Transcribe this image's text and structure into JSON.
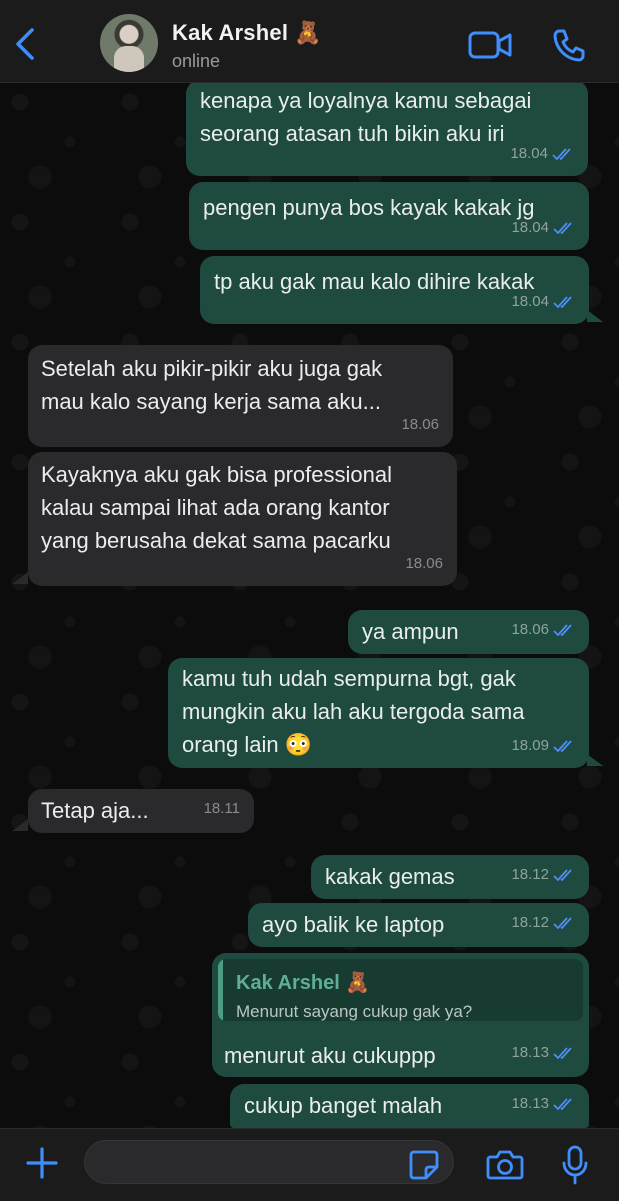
{
  "header": {
    "contact_name": "Kak Arshel 🧸",
    "status": "online"
  },
  "messages": [
    {
      "direction": "out",
      "text": "kenapa ya loyalnya kamu sebagai\nseorang atasan tuh bikin aku iri",
      "time": "18.04"
    },
    {
      "direction": "out",
      "text": "pengen punya bos kayak kakak jg",
      "time": "18.04"
    },
    {
      "direction": "out",
      "text": "tp aku gak mau kalo dihire kakak",
      "time": "18.04"
    },
    {
      "direction": "in",
      "text": "Setelah aku pikir-pikir aku juga gak\nmau kalo sayang kerja sama aku...",
      "time": "18.06"
    },
    {
      "direction": "in",
      "text": "Kayaknya aku gak bisa professional\nkalau sampai lihat ada orang kantor\nyang berusaha dekat sama pacarku",
      "time": "18.06"
    },
    {
      "direction": "out",
      "text": "ya ampun",
      "time": "18.06"
    },
    {
      "direction": "out",
      "text": "kamu tuh udah sempurna bgt, gak\nmungkin aku lah aku tergoda sama\norang lain 😳",
      "time": "18.09"
    },
    {
      "direction": "in",
      "text": "Tetap aja...",
      "time": "18.11"
    },
    {
      "direction": "out",
      "text": "kakak gemas",
      "time": "18.12"
    },
    {
      "direction": "out",
      "text": "ayo balik ke laptop",
      "time": "18.12"
    },
    {
      "direction": "out",
      "text": "menurut aku cukuppp",
      "time": "18.13",
      "quote": {
        "name": "Kak Arshel 🧸",
        "text": "Menurut sayang cukup gak ya?"
      }
    },
    {
      "direction": "out",
      "text": "cukup banget malah",
      "time": "18.13"
    }
  ],
  "colors": {
    "outgoing_bubble": "#1f4a3f",
    "incoming_bubble": "#2a2a2c",
    "accent": "#3f8efc",
    "read_ticks": "#4f8ef7"
  },
  "icons": [
    "chevron-left-icon",
    "video-call-icon",
    "phone-icon",
    "plus-icon",
    "sticker-icon",
    "camera-icon",
    "microphone-icon"
  ]
}
